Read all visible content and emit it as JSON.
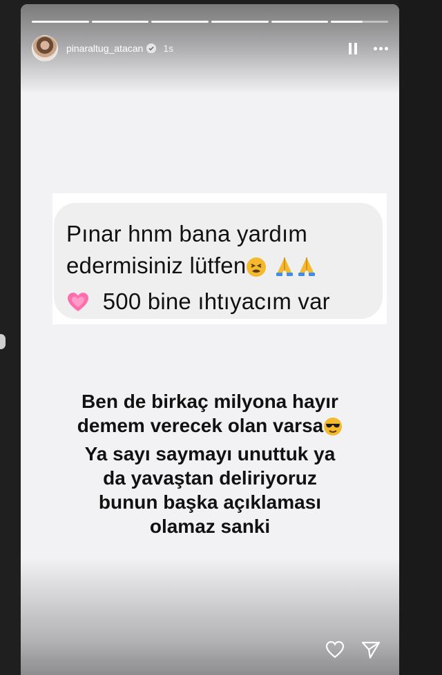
{
  "story": {
    "username": "pinaraltug_atacan",
    "time": "1s",
    "progress_segments": 6,
    "current_segment_fraction": 0.55
  },
  "message": {
    "line1": "Pınar hnm bana yardım",
    "line2": "edermisiniz lütfen",
    "line3": "500 bine ıhtıyacım var",
    "emojis_line2": [
      "tired-face-emoji",
      "folded-hands-emoji",
      "folded-hands-emoji"
    ],
    "emoji_line3": "growing-heart-emoji"
  },
  "caption": {
    "line1": "Ben de birkaç milyona hayır",
    "line2": "demem verecek olan varsa",
    "line2_emoji": "sunglasses-face-emoji",
    "line3": "Ya sayı saymayı unuttuk ya",
    "line4": "da yavaştan deliriyoruz",
    "line5": "bunun başka açıklaması",
    "line6": "olamaz sanki"
  },
  "icons": {
    "pause": "pause-icon",
    "more": "more-icon",
    "like": "heart-icon",
    "share": "send-icon"
  }
}
